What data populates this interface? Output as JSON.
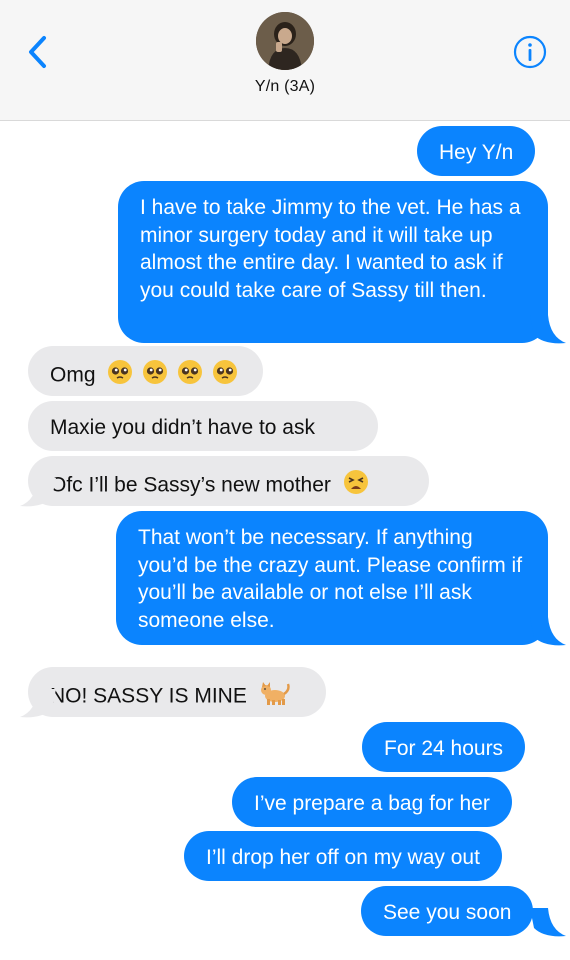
{
  "header": {
    "contact_name": "Y/n (3A)",
    "back_icon": "chevron-left-icon",
    "info_icon": "info-icon",
    "accent_color": "#0b84fe"
  },
  "messages": [
    {
      "side": "sent",
      "text": "Hey Y/n"
    },
    {
      "side": "sent",
      "text": "I have to take Jimmy to the vet. He has a minor surgery today and it will take up almost the entire day. I wanted to ask if you could take care of Sassy till then."
    },
    {
      "side": "received",
      "text": "Omg",
      "emoji": "pleading-face x4"
    },
    {
      "side": "received",
      "text": "Maxie you didn’t have to ask"
    },
    {
      "side": "received",
      "text": "Ofc I’ll be Sassy’s new mother",
      "emoji": "tired-face"
    },
    {
      "side": "sent",
      "text": "That won’t be necessary. If anything you’d be the crazy aunt. Please confirm if you’ll be available or not else I’ll ask someone else."
    },
    {
      "side": "received",
      "text": "NO! SASSY IS MINE",
      "emoji": "cat"
    },
    {
      "side": "sent",
      "text": "For 24 hours"
    },
    {
      "side": "sent",
      "text": "I’ve prepare a bag for her"
    },
    {
      "side": "sent",
      "text": "I’ll drop her off on my way out"
    },
    {
      "side": "sent",
      "text": "See you soon"
    }
  ]
}
